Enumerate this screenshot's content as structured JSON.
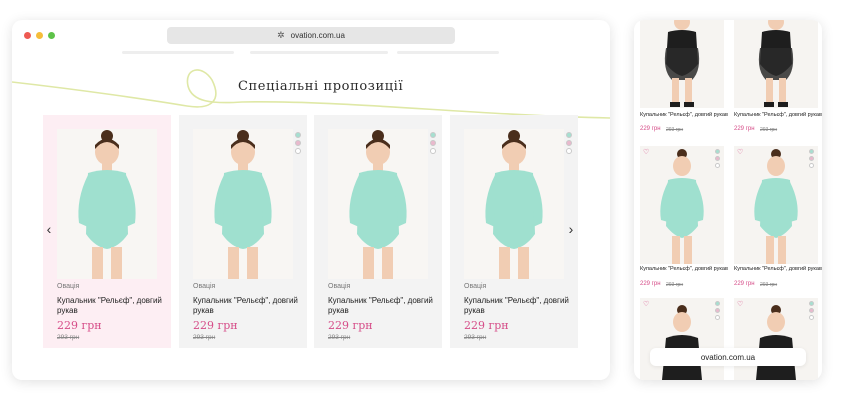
{
  "browser": {
    "url": "ovation.com.ua",
    "logo_icon": "ovation-logo-icon"
  },
  "section": {
    "title": "Спеціальні пропозиції"
  },
  "colors": {
    "accent_pink": "#d64c88",
    "active_card_bg": "#fdeef3",
    "card_bg": "#f3f3f3",
    "swatch_mint": "#a6dfd0",
    "swatch_pink": "#e9b9cd",
    "swatch_white": "#ffffff",
    "leotard_mint": "#9fe0cf",
    "leotard_black": "#1e1e1e",
    "swirl_lime": "#dfe8a6"
  },
  "products": [
    {
      "brand": "Овація",
      "name": "Купальник \"Рельєф\", довгий рукав",
      "price": "229 грн",
      "old_price": "293 грн",
      "active": true
    },
    {
      "brand": "Овація",
      "name": "Купальник \"Рельєф\", довгий рукав",
      "price": "229 грн",
      "old_price": "293 грн",
      "active": false
    },
    {
      "brand": "Овація",
      "name": "Купальник \"Рельєф\", довгий рукав",
      "price": "229 грн",
      "old_price": "293 грн",
      "active": false
    },
    {
      "brand": "Овація",
      "name": "Купальник \"Рельєф\", довгий рукав",
      "price": "229 грн",
      "old_price": "293 грн",
      "active": false
    }
  ],
  "mobile": {
    "url": "ovation.com.ua",
    "products": [
      {
        "name": "Купальник \"Рельєф\", довгий рукав",
        "price": "229 грн",
        "old_price": "293 грн"
      },
      {
        "name": "Купальник \"Рельєф\", довгий рукав",
        "price": "229 грн",
        "old_price": "293 грн"
      },
      {
        "name": "Купальник \"Рельєф\", довгий рукав",
        "price": "229 грн",
        "old_price": "293 грн"
      },
      {
        "name": "Купальник \"Рельєф\", довгий рукав",
        "price": "229 грн",
        "old_price": "293 грн"
      }
    ]
  },
  "icons": {
    "prev": "chevron-left-icon",
    "next": "chevron-right-icon",
    "wishlist": "heart-icon"
  }
}
